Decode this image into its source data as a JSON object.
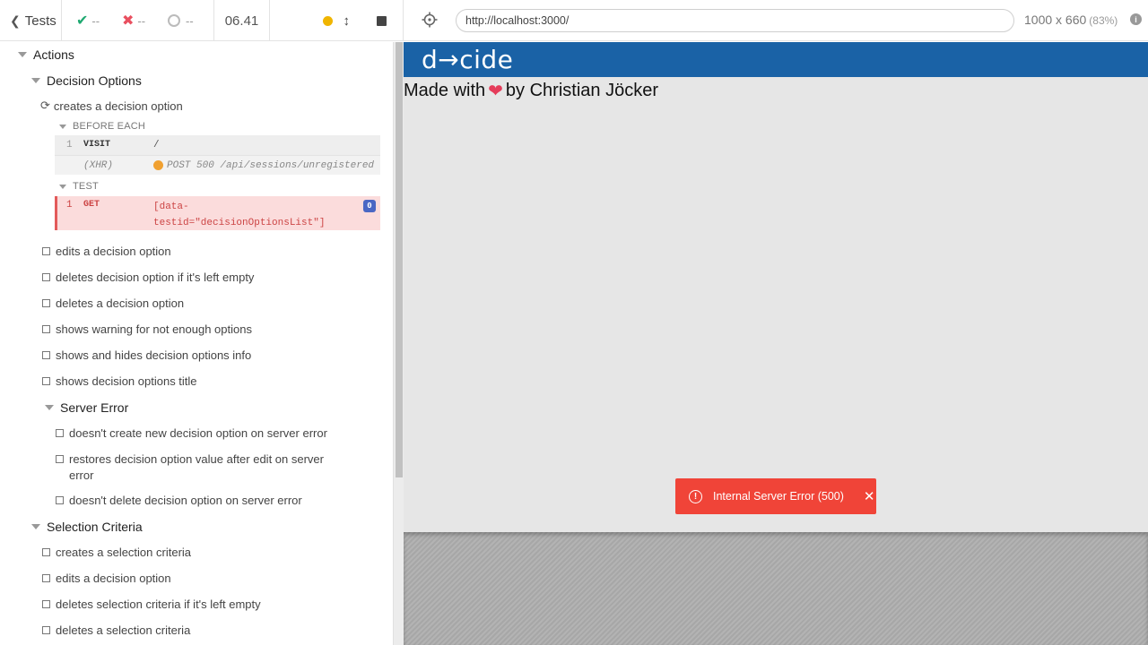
{
  "header": {
    "tests_label": "Tests",
    "passed": "--",
    "failed": "--",
    "pending": "--",
    "duration": "06.41"
  },
  "suites": {
    "root": "Actions",
    "decision_options": "Decision Options",
    "server_error": "Server Error",
    "selection_criteria": "Selection Criteria"
  },
  "running_test": {
    "title": "creates a decision option",
    "before_each": "BEFORE EACH",
    "test_hook": "TEST",
    "commands": [
      {
        "num": "1",
        "name": "VISIT",
        "message": "/"
      },
      {
        "num": "",
        "name": "(XHR)",
        "message": "POST 500 /api/sessions/unregistered"
      },
      {
        "num": "1",
        "name": "GET",
        "message": "[data-\ntestid=\"decisionOptionsList\"]",
        "badge": "0"
      }
    ]
  },
  "decision_tests": [
    "edits a decision option",
    "deletes decision option if it's left empty",
    "deletes a decision option",
    "shows warning for not enough options",
    "shows and hides decision options info",
    "shows decision options title"
  ],
  "server_error_tests": [
    "doesn't create new decision option on server error",
    "restores decision option value after edit on server",
    "error",
    "doesn't delete decision option on server error"
  ],
  "selection_tests": [
    "creates a selection criteria",
    "edits a decision option",
    "deletes selection criteria if it's left empty",
    "deletes a selection criteria"
  ],
  "aut": {
    "url": "http://localhost:3000/",
    "viewport": "1000 x 660",
    "scale": "(83%)",
    "info": "i",
    "app_logo": "d→cide",
    "made_with_prefix": "Made with",
    "heart": "❤",
    "made_with_suffix": "by Christian Jöcker",
    "toast_message": "Internal Server Error (500)",
    "toast_close": "✕"
  },
  "colors": {
    "app_bar": "#1a62a6",
    "toast": "#f04438",
    "pass": "#1fa971",
    "fail": "#e94f5f",
    "running": "#f0b500"
  },
  "icons": [
    "chevron-left-icon",
    "check-icon",
    "x-icon",
    "pending-circle-icon",
    "dot-icon",
    "updown-arrows-icon",
    "stop-icon",
    "crosshair-icon",
    "info-icon",
    "refresh-icon",
    "warning-icon",
    "close-icon"
  ]
}
